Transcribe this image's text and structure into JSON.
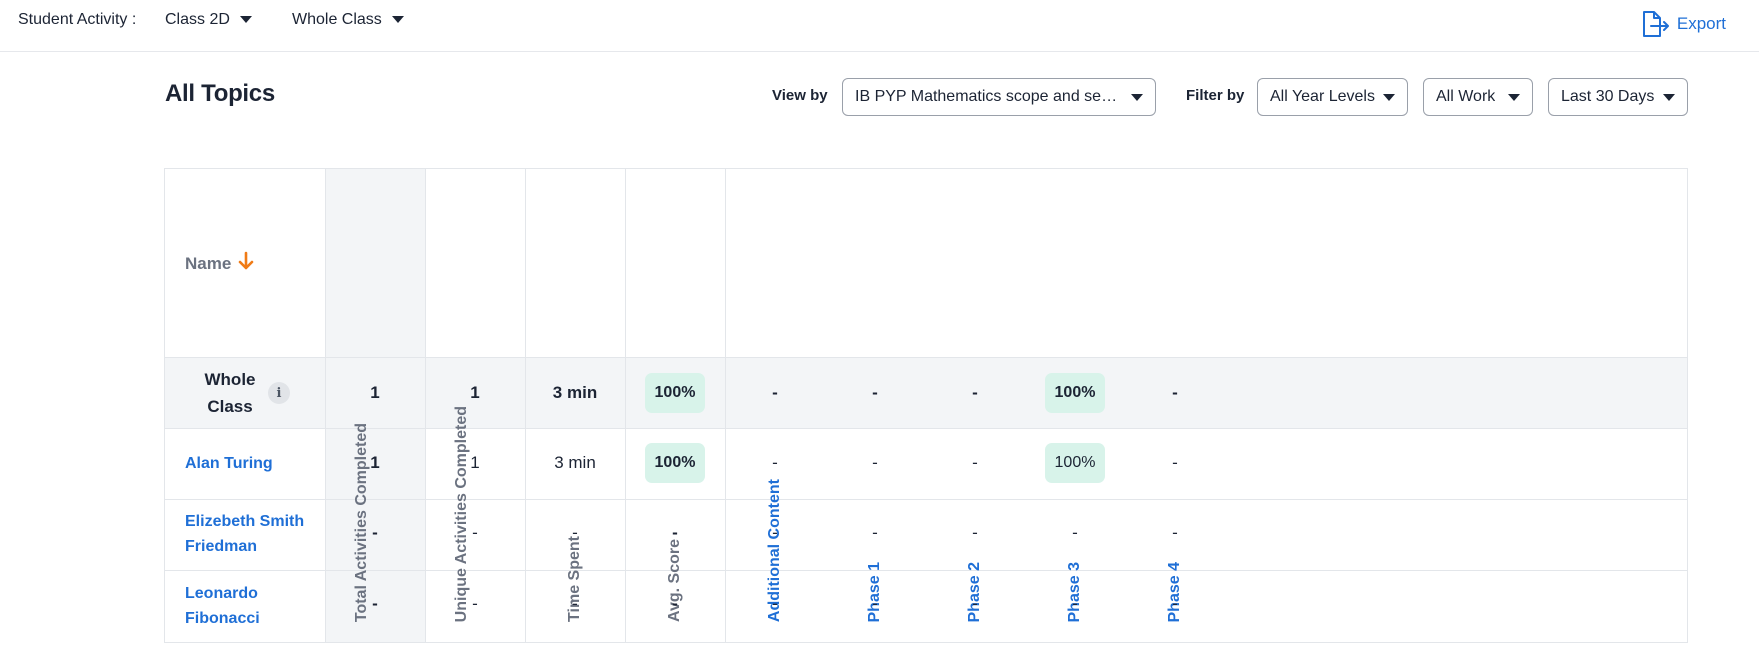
{
  "topbar": {
    "label": "Student Activity :",
    "class_select": "Class 2D",
    "group_select": "Whole Class",
    "export_label": "Export"
  },
  "heading": {
    "title": "All Topics",
    "view_by_label": "View by",
    "view_by_value": "IB PYP Mathematics scope and sequence",
    "filter_by_label": "Filter by",
    "year_levels": "All Year Levels",
    "work": "All Work",
    "period": "Last 30 Days"
  },
  "table": {
    "columns": {
      "name": "Name",
      "total": "Total Activities Completed",
      "unique": "Unique Activities Completed",
      "time": "Time Spent",
      "avg": "Avg. Score",
      "additional": "Additional Content",
      "phase1": "Phase 1",
      "phase2": "Phase 2",
      "phase3": "Phase 3",
      "phase4": "Phase 4"
    },
    "rows": [
      {
        "name": "Whole Class",
        "total": "1",
        "unique": "1",
        "time": "3 min",
        "avg": "100%",
        "additional": "-",
        "phase1": "-",
        "phase2": "-",
        "phase3": "100%",
        "phase4": "-"
      },
      {
        "name": "Alan Turing",
        "total": "1",
        "unique": "1",
        "time": "3 min",
        "avg": "100%",
        "additional": "-",
        "phase1": "-",
        "phase2": "-",
        "phase3": "100%",
        "phase4": "-"
      },
      {
        "name": "Elizebeth Smith Friedman",
        "total": "-",
        "unique": "-",
        "time": "-",
        "avg": "-",
        "additional": "-",
        "phase1": "-",
        "phase2": "-",
        "phase3": "-",
        "phase4": "-"
      },
      {
        "name": "Leonardo Fibonacci",
        "total": "-",
        "unique": "-",
        "time": "-",
        "avg": "-",
        "additional": "-",
        "phase1": "-",
        "phase2": "-",
        "phase3": "-",
        "phase4": "-"
      }
    ]
  },
  "colors": {
    "accent": "#1f6fd6",
    "sort_arrow": "#f07b16",
    "score_badge": "#d8f3ea"
  }
}
